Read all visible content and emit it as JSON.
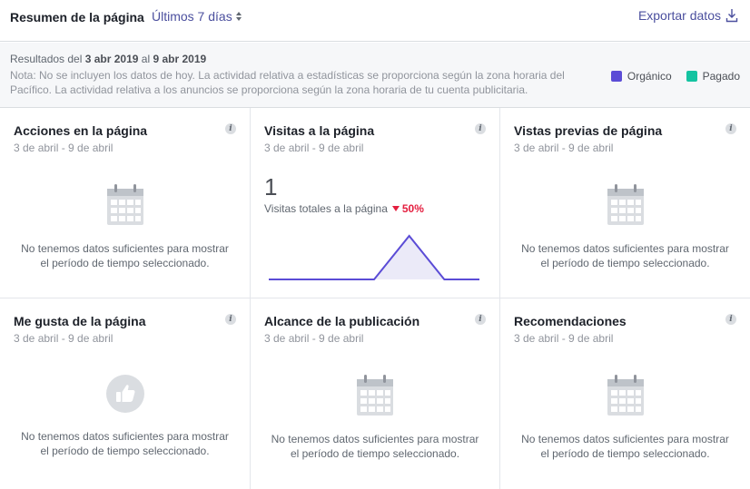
{
  "header": {
    "title": "Resumen de la página",
    "range_label": "Últimos 7 días",
    "export_label": "Exportar datos"
  },
  "notes": {
    "results_prefix": "Resultados del",
    "start_date": "3 abr 2019",
    "connector": "al",
    "end_date": "9 abr 2019",
    "note": "Nota: No se incluyen los datos de hoy. La actividad relativa a estadísticas se proporciona según la zona horaria del Pacífico. La actividad relativa a los anuncios se proporciona según la zona horaria de tu cuenta publicitaria."
  },
  "legend": [
    {
      "label": "Orgánico",
      "color": "#5b4cd6"
    },
    {
      "label": "Pagado",
      "color": "#14c3a1"
    }
  ],
  "empty_message": "No tenemos datos suficientes para mostrar el período de tiempo seleccionado.",
  "cards": [
    {
      "title": "Acciones en la página",
      "date": "3 de abril - 9 de abril",
      "icon": "calendar-icon"
    },
    {
      "title": "Visitas a la página",
      "date": "3 de abril - 9 de abril",
      "value": "1",
      "metric_label": "Visitas totales a la página",
      "change": "50%",
      "change_direction": "down"
    },
    {
      "title": "Vistas previas de página",
      "date": "3 de abril - 9 de abril",
      "icon": "calendar-icon"
    },
    {
      "title": "Me gusta de la página",
      "date": "3 de abril - 9 de abril",
      "icon": "thumbs-up-icon"
    },
    {
      "title": "Alcance de la publicación",
      "date": "3 de abril - 9 de abril",
      "icon": "calendar-icon"
    },
    {
      "title": "Recomendaciones",
      "date": "3 de abril - 9 de abril",
      "icon": "calendar-icon"
    }
  ],
  "page_visits_series": [
    0,
    0,
    0,
    0,
    1,
    0,
    0
  ],
  "info_glyph": "i"
}
